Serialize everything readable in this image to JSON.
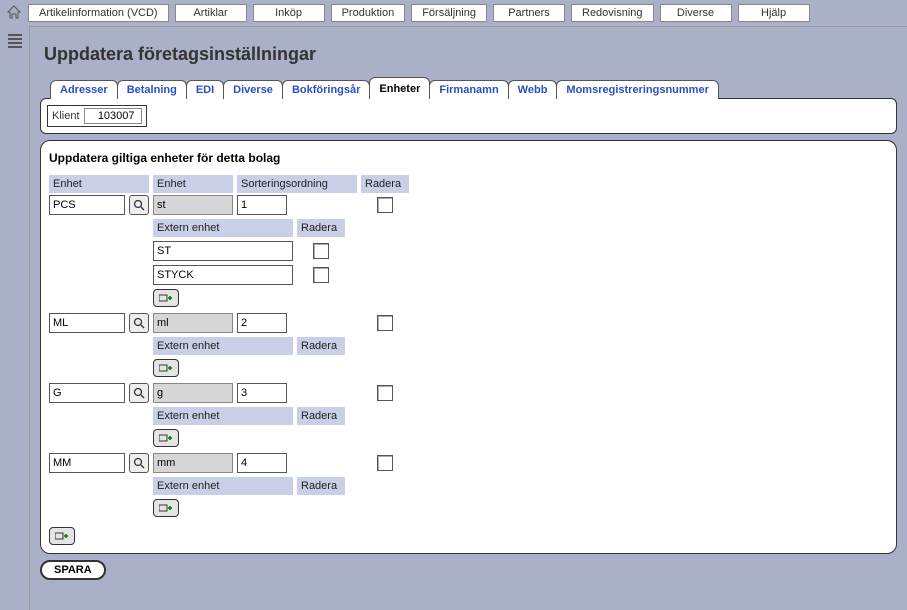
{
  "menu": {
    "items": [
      "Artikelinformation (VCD)",
      "Artiklar",
      "Inköp",
      "Produktion",
      "Försäljning",
      "Partners",
      "Redovisning",
      "Diverse",
      "Hjälp"
    ]
  },
  "page": {
    "title": "Uppdatera företagsinställningar"
  },
  "tabs": {
    "items": [
      "Adresser",
      "Betalning",
      "EDI",
      "Diverse",
      "Bokföringsår",
      "Enheter",
      "Firmanamn",
      "Webb",
      "Momsregistreringsnummer"
    ],
    "active_index": 5
  },
  "klient": {
    "label": "Klient",
    "value": "103007"
  },
  "content": {
    "section_title": "Uppdatera giltiga enheter för detta bolag",
    "headers": {
      "enhet1": "Enhet",
      "enhet2": "Enhet",
      "sort": "Sorteringsordning",
      "radera": "Radera"
    },
    "sub_headers": {
      "ext": "Extern enhet",
      "radera": "Radera"
    },
    "rows": [
      {
        "code": "PCS",
        "label": "st",
        "sort": "1",
        "externals": [
          "ST",
          "STYCK"
        ]
      },
      {
        "code": "ML",
        "label": "ml",
        "sort": "2",
        "externals": []
      },
      {
        "code": "G",
        "label": "g",
        "sort": "3",
        "externals": []
      },
      {
        "code": "MM",
        "label": "mm",
        "sort": "4",
        "externals": []
      }
    ],
    "save_label": "SPARA"
  }
}
